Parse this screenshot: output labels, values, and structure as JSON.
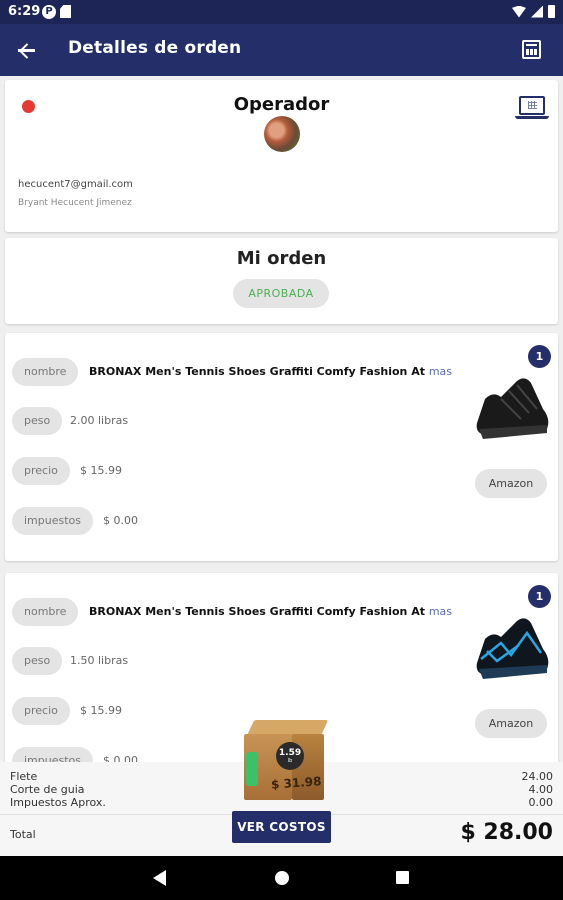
{
  "status_bar": {
    "time": "6:29",
    "p_icon": "P"
  },
  "app_bar": {
    "title": "Detalles de orden"
  },
  "operator": {
    "title": "Operador",
    "status_color": "#e53935",
    "email": "hecucent7@gmail.com",
    "name": "Bryant Hecucent Jimenez"
  },
  "order": {
    "title": "Mi orden",
    "status": "APROBADA",
    "status_color": "#4caf50"
  },
  "labels": {
    "nombre": "nombre",
    "peso": "peso",
    "precio": "precio",
    "impuestos": "impuestos",
    "mas": "mas",
    "amazon": "Amazon"
  },
  "products": [
    {
      "name": "BRONAX Men's Tennis Shoes Graffiti Comfy Fashion At",
      "weight": "2.00 libras",
      "price": "$ 15.99",
      "tax": "$ 0.00",
      "quantity": "1"
    },
    {
      "name": "BRONAX Men's Tennis Shoes Graffiti Comfy Fashion At",
      "weight": "1.50 libras",
      "price": "$ 15.99",
      "tax": "$ 0.00",
      "quantity": "1"
    }
  ],
  "package": {
    "weight": "1.59",
    "unit": "lb",
    "price": "$ 31.98"
  },
  "summary": {
    "flete_label": "Flete",
    "flete_value": "24.00",
    "corte_label": "Corte de guia",
    "corte_value": "4.00",
    "impuestos_label": "Impuestos Aprox.",
    "impuestos_value": "0.00",
    "total_label": "Total",
    "total_value": "$ 28.00",
    "costs_button": "VER COSTOS"
  },
  "colors": {
    "primary": "#242f6a",
    "status_bar": "#1d2557"
  }
}
